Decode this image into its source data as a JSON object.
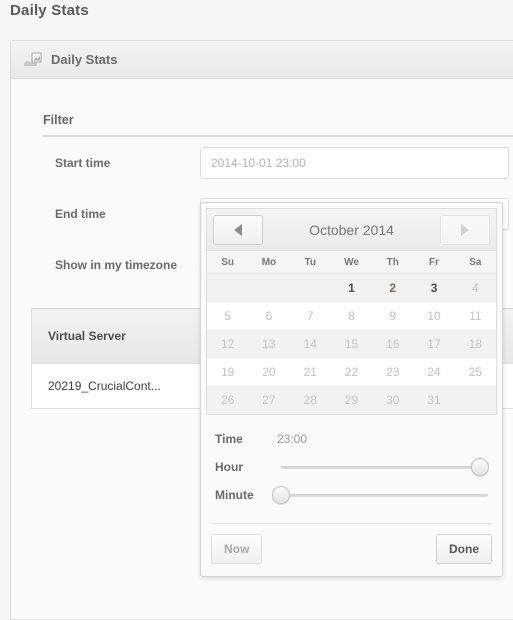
{
  "page": {
    "title": "Daily Stats"
  },
  "panel": {
    "title": "Daily Stats",
    "icon": "chart-image-icon"
  },
  "filter": {
    "legend": "Filter",
    "rows": [
      {
        "label": "Start time",
        "value": "2014-10-01 23:00",
        "placeholder": ""
      },
      {
        "label": "End time",
        "value": "",
        "placeholder": ""
      },
      {
        "label": "Show in my timezone",
        "checkbox_glyph": "✕"
      }
    ]
  },
  "table": {
    "columns": [
      "Virtual Server"
    ],
    "rows": [
      [
        "20219_CrucialCont..."
      ]
    ]
  },
  "datepicker": {
    "prev_label": "◀",
    "next_label": "▶",
    "month_label": "October 2014",
    "weekdays": [
      "Su",
      "Mo",
      "Tu",
      "We",
      "Th",
      "Fr",
      "Sa"
    ],
    "weeks": [
      [
        {
          "day": "",
          "state": "blank"
        },
        {
          "day": "",
          "state": "blank"
        },
        {
          "day": "",
          "state": "blank"
        },
        {
          "day": "1",
          "state": "enabled"
        },
        {
          "day": "2",
          "state": "today"
        },
        {
          "day": "3",
          "state": "enabled"
        },
        {
          "day": "4",
          "state": "disabled"
        }
      ],
      [
        {
          "day": "5",
          "state": "disabled"
        },
        {
          "day": "6",
          "state": "disabled"
        },
        {
          "day": "7",
          "state": "disabled"
        },
        {
          "day": "8",
          "state": "disabled"
        },
        {
          "day": "9",
          "state": "disabled"
        },
        {
          "day": "10",
          "state": "disabled"
        },
        {
          "day": "11",
          "state": "disabled"
        }
      ],
      [
        {
          "day": "12",
          "state": "disabled"
        },
        {
          "day": "13",
          "state": "disabled"
        },
        {
          "day": "14",
          "state": "disabled"
        },
        {
          "day": "15",
          "state": "disabled"
        },
        {
          "day": "16",
          "state": "disabled"
        },
        {
          "day": "17",
          "state": "disabled"
        },
        {
          "day": "18",
          "state": "disabled"
        }
      ],
      [
        {
          "day": "19",
          "state": "disabled"
        },
        {
          "day": "20",
          "state": "disabled"
        },
        {
          "day": "21",
          "state": "disabled"
        },
        {
          "day": "22",
          "state": "disabled"
        },
        {
          "day": "23",
          "state": "disabled"
        },
        {
          "day": "24",
          "state": "disabled"
        },
        {
          "day": "25",
          "state": "disabled"
        }
      ],
      [
        {
          "day": "26",
          "state": "disabled"
        },
        {
          "day": "27",
          "state": "disabled"
        },
        {
          "day": "28",
          "state": "disabled"
        },
        {
          "day": "29",
          "state": "disabled"
        },
        {
          "day": "30",
          "state": "disabled"
        },
        {
          "day": "31",
          "state": "disabled"
        },
        {
          "day": "",
          "state": "blank"
        }
      ]
    ],
    "time": {
      "label": "Time",
      "value": "23:00",
      "hour_label": "Hour",
      "hour_percent": 96,
      "minute_label": "Minute",
      "minute_percent": 0
    },
    "buttons": {
      "now": "Now",
      "done": "Done"
    }
  }
}
